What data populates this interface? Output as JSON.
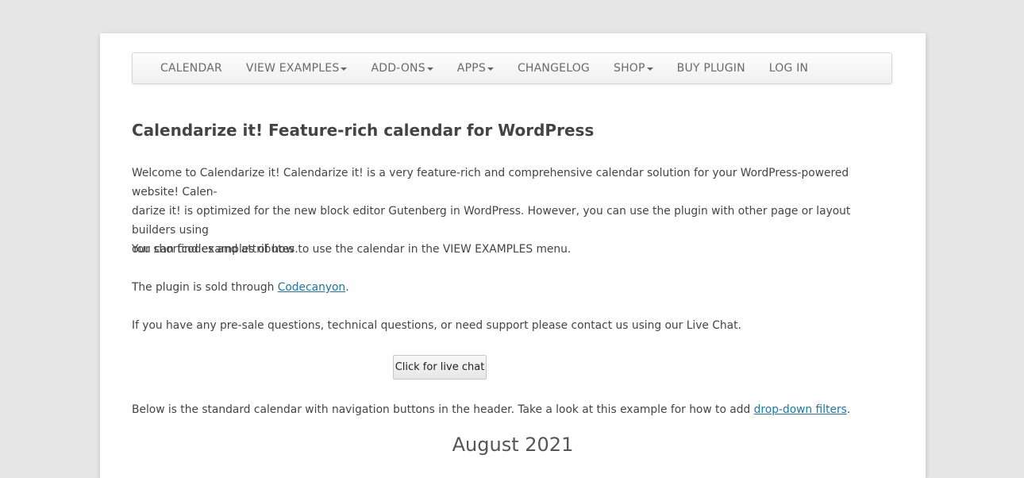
{
  "nav": {
    "items": [
      {
        "label": "CALENDAR",
        "dropdown": false
      },
      {
        "label": "VIEW EXAMPLES",
        "dropdown": true
      },
      {
        "label": "ADD-ONS",
        "dropdown": true
      },
      {
        "label": "APPS",
        "dropdown": true
      },
      {
        "label": "CHANGELOG",
        "dropdown": false
      },
      {
        "label": "SHOP",
        "dropdown": true
      },
      {
        "label": "BUY PLUGIN",
        "dropdown": false
      },
      {
        "label": "LOG IN",
        "dropdown": false
      }
    ]
  },
  "content": {
    "title": "Calendarize it! Feature-rich calendar for WordPress",
    "intro_line1": "Welcome to Calendarize it! Calendarize it! is a very feature-rich and comprehensive calendar solution for your WordPress-powered website! Calen-",
    "intro_line2": "darize it! is optimized for the new block editor Gutenberg in WordPress. However, you can use the plugin with other page or layout builders using",
    "intro_line3": "our shortcodes and attributes.",
    "examples_text": "You can find examples of how to use the calendar in the VIEW EXAMPLES menu.",
    "sold_prefix": "The plugin is sold through ",
    "sold_link": "Codecanyon",
    "sold_suffix": ".",
    "support_text": "If you have any pre-sale questions, technical questions, or need support please contact us using our Live Chat.",
    "chat_button": "Click for live chat",
    "below_prefix": "Below is the standard calendar with navigation buttons in the header. Take a look at this example for how to add ",
    "below_link": "drop-down filters",
    "below_suffix": ".",
    "month_title": "August 2021"
  },
  "colors": {
    "background": "#e6e6e6",
    "link": "#21759b",
    "text": "#444444"
  }
}
